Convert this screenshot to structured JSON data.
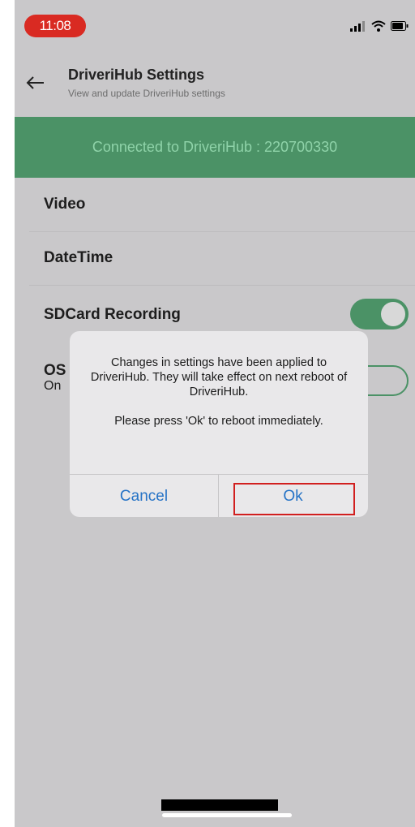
{
  "status_bar": {
    "time": "11:08"
  },
  "header": {
    "title": "DriveriHub Settings",
    "subtitle": "View and update DriveriHub settings"
  },
  "banner": {
    "text": "Connected to DriveriHub : 220700330"
  },
  "settings": {
    "video": "Video",
    "datetime": "DateTime",
    "sdcard_label": "SDCard Recording",
    "sdcard_enabled": true,
    "osd_label": "OS",
    "osd_value": "On"
  },
  "dialog": {
    "message": "Changes in settings have been applied to DriveriHub. They will take effect on next reboot of DriveriHub.",
    "prompt": "Please press 'Ok' to reboot immediately.",
    "cancel_label": "Cancel",
    "ok_label": "Ok"
  },
  "colors": {
    "accent": "#4b9266",
    "time_pill": "#d92a22",
    "button_text": "#2673c6",
    "highlight": "#d11f1f"
  }
}
